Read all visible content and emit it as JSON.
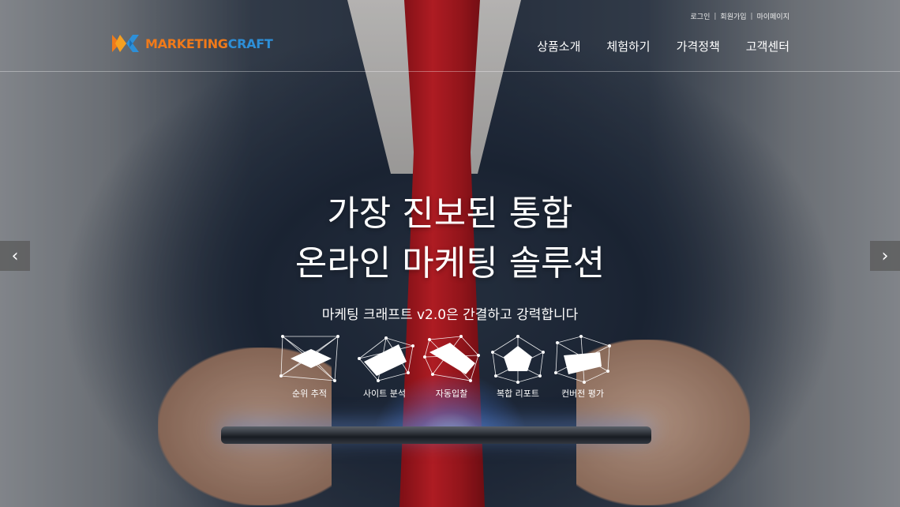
{
  "utility_nav": {
    "login": "로그인",
    "signup": "회원가입",
    "mypage": "마이페이지",
    "separator": "|"
  },
  "logo": {
    "part1": "MARKETING",
    "part2": "CRAFT",
    "color1": "#f07a1a",
    "color2": "#2d8fd8"
  },
  "main_nav": {
    "items": [
      {
        "label": "상품소개"
      },
      {
        "label": "체험하기"
      },
      {
        "label": "가격정책"
      },
      {
        "label": "고객센터"
      }
    ]
  },
  "hero": {
    "headline_line1": "가장 진보된 통합",
    "headline_line2": "온라인 마케팅 솔루션",
    "subline": "마케팅 크래프트 v2.0은 간결하고 강력합니다",
    "features": [
      {
        "label": "순위 추적",
        "icon": "rank-tracking-icon"
      },
      {
        "label": "사이트 분석",
        "icon": "site-analysis-icon"
      },
      {
        "label": "자동입찰",
        "icon": "auto-bidding-icon"
      },
      {
        "label": "복합 리포트",
        "icon": "composite-report-icon"
      },
      {
        "label": "컨버전 평가",
        "icon": "conversion-evaluation-icon"
      }
    ]
  },
  "slider": {
    "prev_icon": "chevron-left-icon",
    "next_icon": "chevron-right-icon",
    "prev_glyph": "‹",
    "next_glyph": "›"
  }
}
